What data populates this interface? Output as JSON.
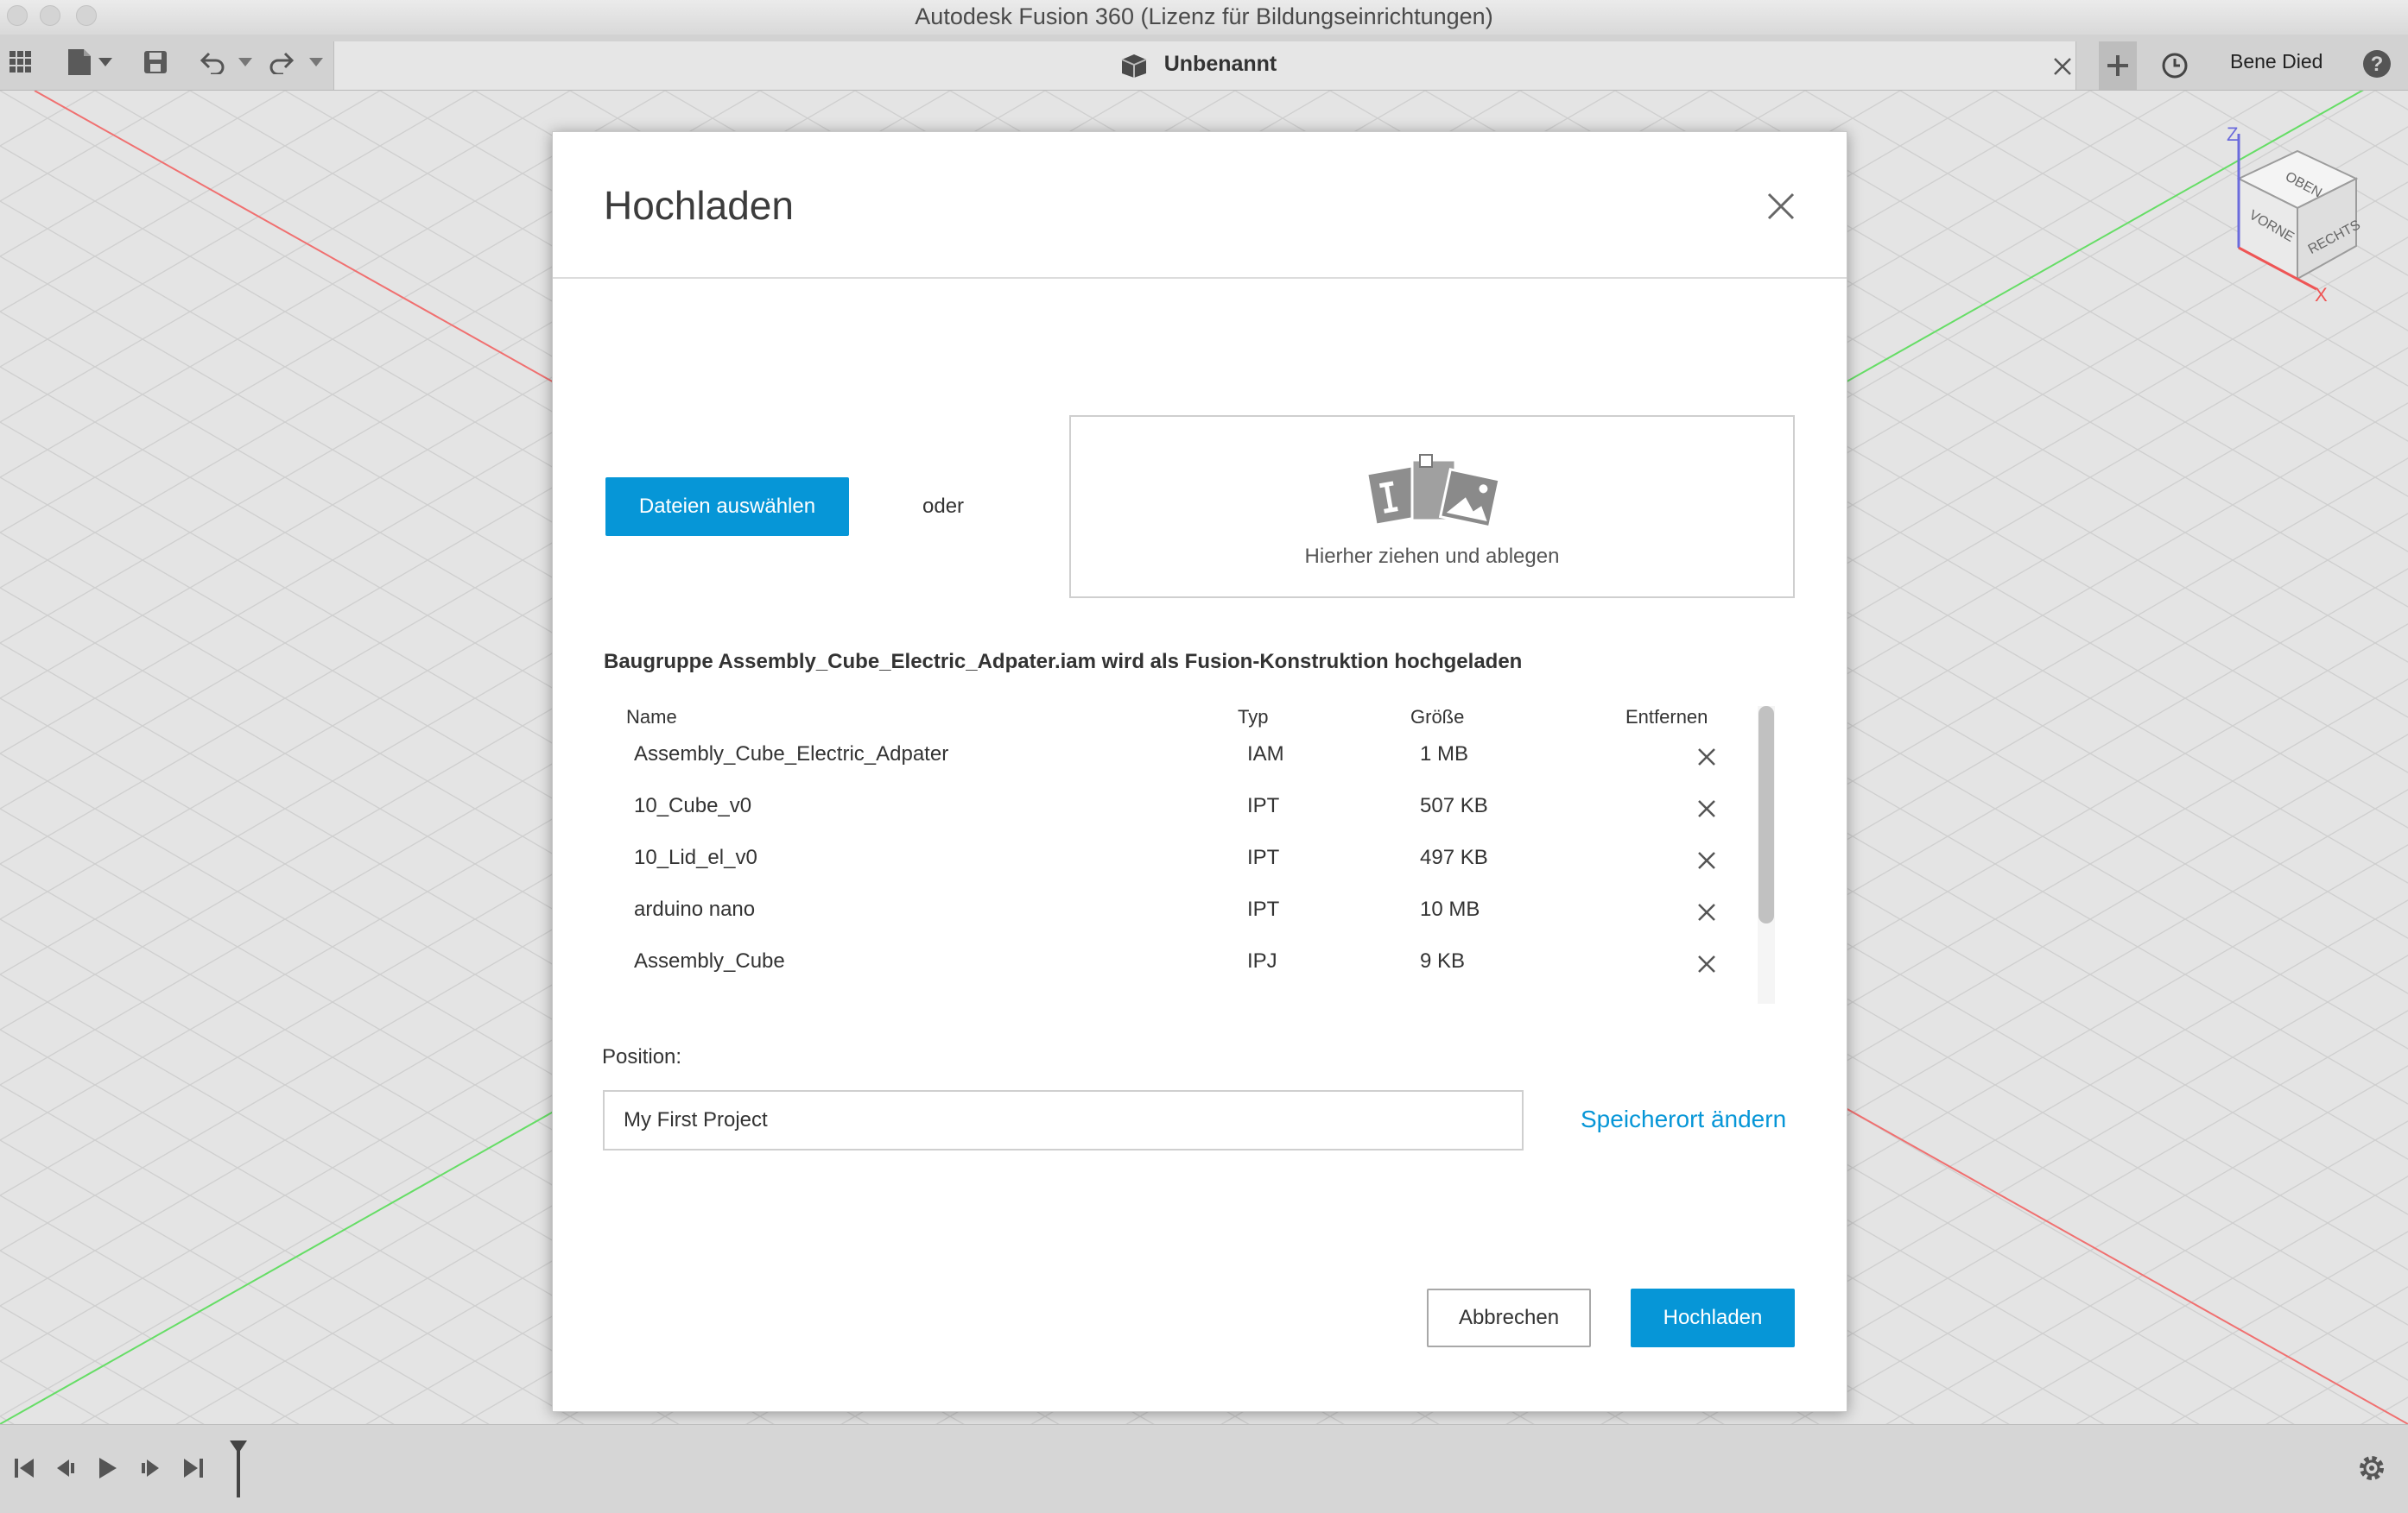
{
  "window": {
    "title": "Autodesk Fusion 360 (Lizenz für Bildungseinrichtungen)"
  },
  "toolbar": {
    "icons": [
      "grid-icon",
      "file-icon",
      "save-icon",
      "undo-icon",
      "redo-icon"
    ],
    "document_tab": "Unbenannt",
    "user_name": "Bene Died"
  },
  "viewcube": {
    "top": "OBEN",
    "front": "VORNE",
    "right": "RECHTS",
    "axis_z": "Z",
    "axis_x": "X"
  },
  "dialog": {
    "title": "Hochladen",
    "select_button": "Dateien auswählen",
    "or_text": "oder",
    "drop_text": "Hierher ziehen und ablegen",
    "info_text": "Baugruppe Assembly_Cube_Electric_Adpater.iam wird als Fusion-Konstruktion hochgeladen",
    "columns": {
      "name": "Name",
      "type": "Typ",
      "size": "Größe",
      "remove": "Entfernen"
    },
    "files": [
      {
        "name": "Assembly_Cube_Electric_Adpater",
        "type": "IAM",
        "size": "1 MB"
      },
      {
        "name": "10_Cube_v0",
        "type": "IPT",
        "size": "507 KB"
      },
      {
        "name": "10_Lid_el_v0",
        "type": "IPT",
        "size": "497 KB"
      },
      {
        "name": "arduino nano",
        "type": "IPT",
        "size": "10 MB"
      },
      {
        "name": "Assembly_Cube",
        "type": "IPJ",
        "size": "9 KB"
      }
    ],
    "position_label": "Position:",
    "position_value": "My First Project",
    "change_location": "Speicherort ändern",
    "cancel_button": "Abbrechen",
    "upload_button": "Hochladen"
  },
  "colors": {
    "accent": "#0696d7",
    "axis_red": "#f07070",
    "axis_green": "#66dd66"
  }
}
